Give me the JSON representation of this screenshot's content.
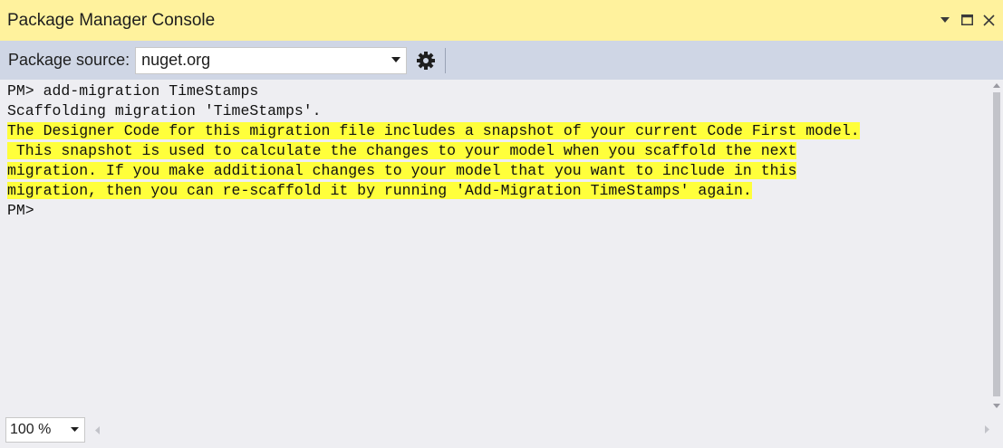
{
  "window": {
    "title": "Package Manager Console",
    "controls": [
      "dropdown-icon",
      "maximize-icon",
      "close-icon"
    ]
  },
  "toolbar": {
    "source_label": "Package source:",
    "source_value": "nuget.org",
    "settings_icon": "gear-icon"
  },
  "console": {
    "lines": [
      "PM> add-migration TimeStamps",
      "Scaffolding migration 'TimeStamps'.",
      "The Designer Code for this migration file includes a snapshot of your current Code First model.",
      " This snapshot is used to calculate the changes to your model when you scaffold the next",
      "migration. If you make additional changes to your model that you want to include in this",
      "migration, then you can re-scaffold it by running 'Add-Migration TimeStamps' again.",
      "PM>"
    ],
    "highlight_color": "#ffff3b"
  },
  "status": {
    "zoom": "100 %"
  },
  "colors": {
    "titlebar": "#fff29d",
    "toolbar": "#cfd6e5",
    "console_bg": "#eeeef2"
  }
}
